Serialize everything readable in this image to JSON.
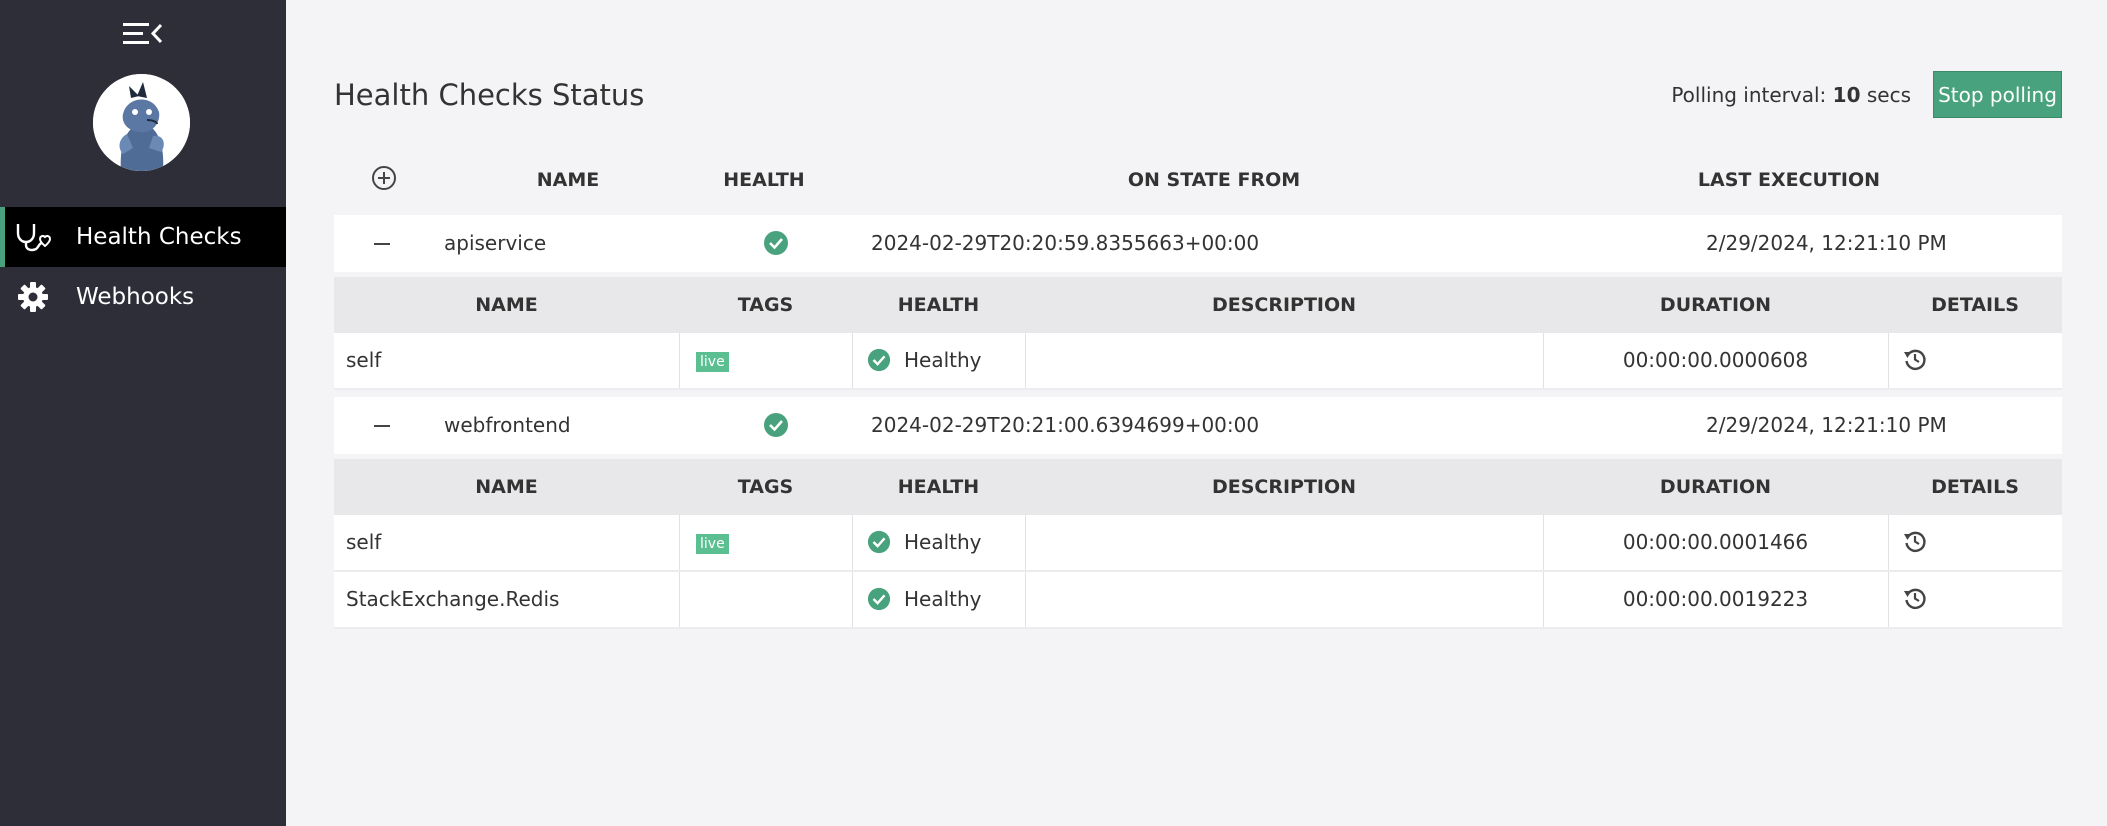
{
  "sidebar": {
    "nav": [
      {
        "label": "Health Checks",
        "icon": "stethoscope-icon",
        "active": true
      },
      {
        "label": "Webhooks",
        "icon": "gear-icon",
        "active": false
      }
    ]
  },
  "header": {
    "title": "Health Checks Status",
    "polling_prefix": "Polling interval:",
    "polling_value": "10",
    "polling_suffix": "secs",
    "stop_button": "Stop polling"
  },
  "table": {
    "columns": [
      "NAME",
      "HEALTH",
      "ON STATE FROM",
      "LAST EXECUTION"
    ],
    "sub_columns": [
      "NAME",
      "TAGS",
      "HEALTH",
      "DESCRIPTION",
      "DURATION",
      "DETAILS"
    ],
    "services": [
      {
        "name": "apiservice",
        "on_state_from": "2024-02-29T20:20:59.8355663+00:00",
        "last_execution": "2/29/2024, 12:21:10 PM",
        "entries": [
          {
            "name": "self",
            "tag": "live",
            "health": "Healthy",
            "description": "",
            "duration": "00:00:00.0000608"
          }
        ]
      },
      {
        "name": "webfrontend",
        "on_state_from": "2024-02-29T20:21:00.6394699+00:00",
        "last_execution": "2/29/2024, 12:21:10 PM",
        "entries": [
          {
            "name": "self",
            "tag": "live",
            "health": "Healthy",
            "description": "",
            "duration": "00:00:00.0001466"
          },
          {
            "name": "StackExchange.Redis",
            "tag": "",
            "health": "Healthy",
            "description": "",
            "duration": "00:00:00.0019223"
          }
        ]
      }
    ]
  },
  "colors": {
    "sidebar_bg": "#2d2e38",
    "accent": "#48a27d",
    "tag_bg": "#5cbf92",
    "healthy": "#48a27d"
  }
}
